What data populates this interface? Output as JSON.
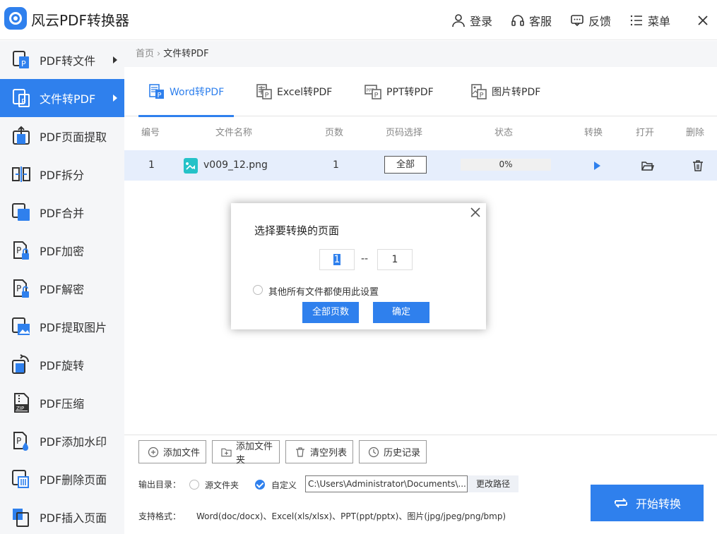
{
  "app": {
    "title": "风云PDF转换器",
    "accent": "#2f80ed",
    "top_actions": [
      {
        "label": "登录",
        "icon": "user-icon"
      },
      {
        "label": "客服",
        "icon": "headset-icon"
      },
      {
        "label": "反馈",
        "icon": "chat-icon"
      },
      {
        "label": "菜单",
        "icon": "menu-icon"
      }
    ]
  },
  "sidebar": {
    "items": [
      {
        "label": "PDF转文件",
        "icon": "pdf-to-file-icon",
        "arrow": true,
        "active": false
      },
      {
        "label": "文件转PDF",
        "icon": "file-to-pdf-icon",
        "arrow": true,
        "active": true
      },
      {
        "label": "PDF页面提取",
        "icon": "page-extract-icon",
        "active": false
      },
      {
        "label": "PDF拆分",
        "icon": "split-icon",
        "active": false
      },
      {
        "label": "PDF合并",
        "icon": "merge-icon",
        "active": false
      },
      {
        "label": "PDF加密",
        "icon": "lock-icon",
        "active": false
      },
      {
        "label": "PDF解密",
        "icon": "unlock-icon",
        "active": false
      },
      {
        "label": "PDF提取图片",
        "icon": "image-extract-icon",
        "active": false
      },
      {
        "label": "PDF旋转",
        "icon": "rotate-icon",
        "active": false
      },
      {
        "label": "PDF压缩",
        "icon": "zip-icon",
        "active": false
      },
      {
        "label": "PDF添加水印",
        "icon": "watermark-icon",
        "active": false
      },
      {
        "label": "PDF删除页面",
        "icon": "delete-page-icon",
        "active": false
      },
      {
        "label": "PDF插入页面",
        "icon": "insert-page-icon",
        "active": false
      }
    ]
  },
  "breadcrumb": {
    "home": "首页",
    "current": "文件转PDF"
  },
  "tabs": [
    {
      "label": "Word转PDF",
      "active": true
    },
    {
      "label": "Excel转PDF",
      "active": false
    },
    {
      "label": "PPT转PDF",
      "active": false
    },
    {
      "label": "图片转PDF",
      "active": false
    }
  ],
  "table": {
    "headers": [
      "编号",
      "文件名称",
      "页数",
      "页码选择",
      "状态",
      "转换",
      "打开",
      "删除"
    ],
    "rows": [
      {
        "index": "1",
        "filename": "v009_12.png",
        "pages": "1",
        "page_select": "全部",
        "progress": "0%"
      }
    ]
  },
  "toolbar": {
    "add_file": "添加文件",
    "add_folder": "添加文件夹",
    "clear_list": "清空列表",
    "history": "历史记录"
  },
  "output": {
    "label": "输出目录：",
    "option_source": "源文件夹",
    "option_custom": "自定义",
    "selected": "自定义",
    "path": "C:\\Users\\Administrator\\Documents\\...",
    "change_path": "更改路径"
  },
  "formats": {
    "label": "支持格式：",
    "text": "Word(doc/docx)、Excel(xls/xlsx)、PPT(ppt/pptx)、图片(jpg/jpeg/png/bmp)"
  },
  "start_button": "开始转换",
  "dialog": {
    "title": "选择要转换的页面",
    "from": "1",
    "separator": "--",
    "to": "1",
    "apply_all": "其他所有文件都使用此设置",
    "all_pages": "全部页数",
    "confirm": "确定"
  }
}
